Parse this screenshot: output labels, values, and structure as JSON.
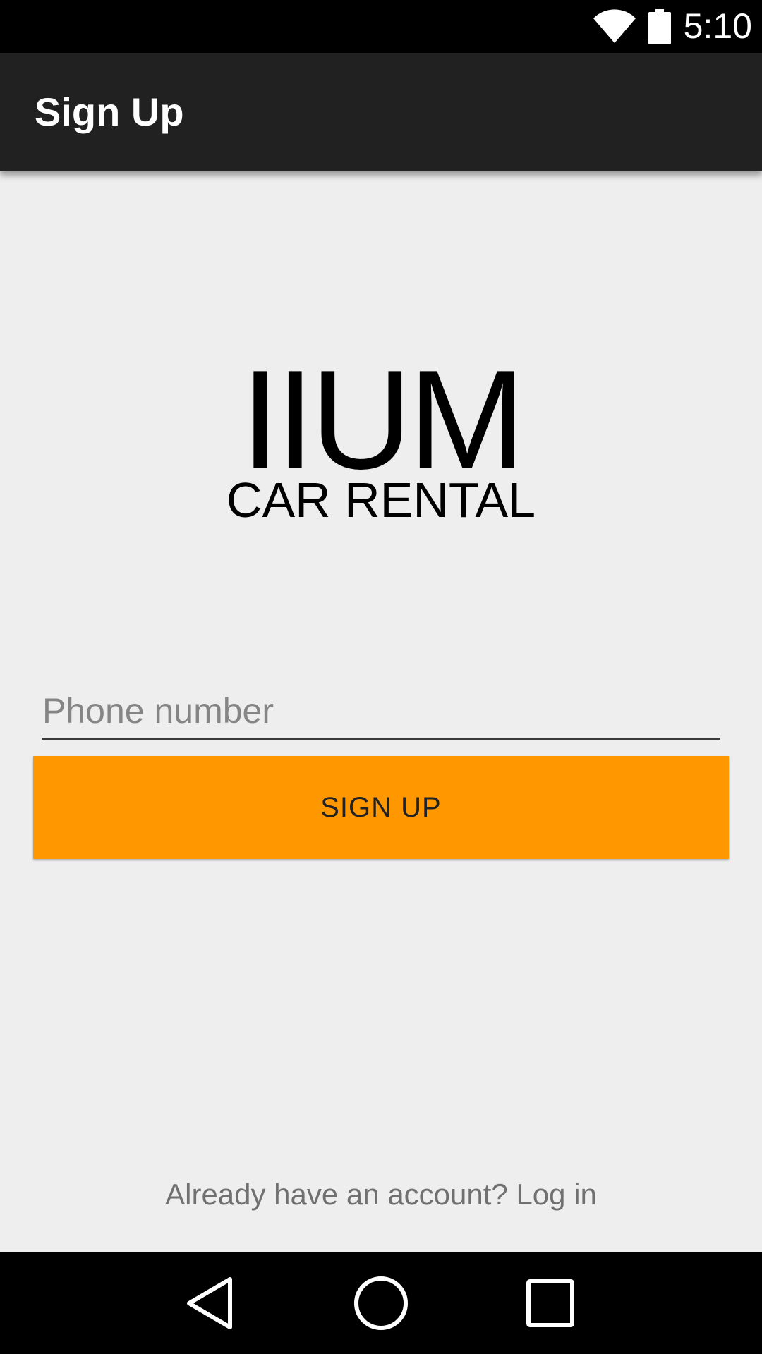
{
  "status_bar": {
    "time": "5:10",
    "icons": [
      "wifi-icon",
      "battery-icon"
    ]
  },
  "app_bar": {
    "title": "Sign Up"
  },
  "logo": {
    "line1": "IIUM",
    "line2": "CAR RENTAL"
  },
  "form": {
    "phone_placeholder": "Phone number",
    "phone_value": "",
    "signup_label": "SIGN UP"
  },
  "footer": {
    "login_text": "Already have an account? Log in"
  },
  "nav_bar": {
    "icons": [
      "back-icon",
      "home-icon",
      "recents-icon"
    ]
  },
  "colors": {
    "status_bar": "#000000",
    "app_bar": "#212121",
    "background": "#eeeeee",
    "accent": "#ff9800",
    "nav_bar": "#000000"
  }
}
